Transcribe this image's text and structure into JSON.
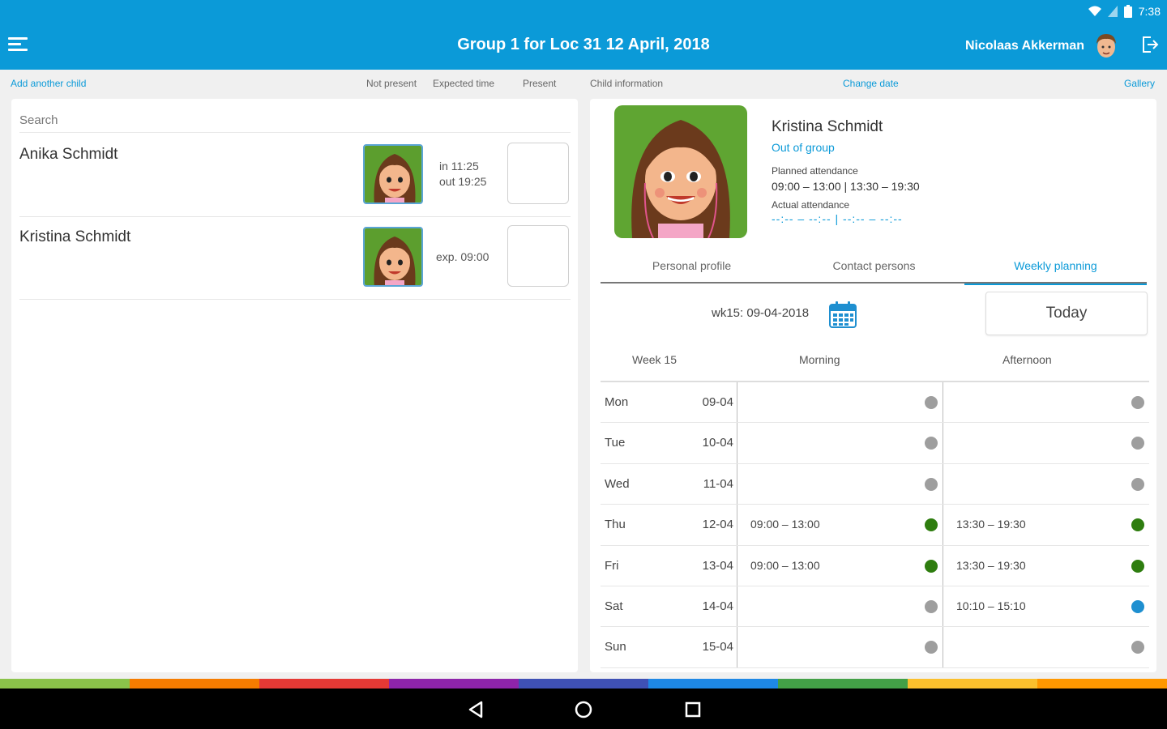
{
  "status_bar": {
    "time": "7:38",
    "icons": [
      "wifi-icon",
      "signal-icon",
      "battery-icon"
    ]
  },
  "app_bar": {
    "title": "Group 1 for Loc 31 12 April, 2018",
    "user_name": "Nicolaas Akkerman",
    "icons": [
      "menu-icon",
      "logout-icon"
    ]
  },
  "sub_header": {
    "add_child": "Add another child",
    "not_present": "Not present",
    "expected_time": "Expected time",
    "present": "Present",
    "child_information": "Child information",
    "change_date": "Change date",
    "gallery": "Gallery"
  },
  "children_list": {
    "search_placeholder": "Search",
    "items": [
      {
        "name": "Anika Schmidt",
        "time_line1": "in 11:25",
        "time_line2": "out 19:25"
      },
      {
        "name": "Kristina Schmidt",
        "time_line1": "exp. 09:00",
        "time_line2": ""
      }
    ]
  },
  "child_detail": {
    "name": "Kristina Schmidt",
    "status_link": "Out of group",
    "planned_label": "Planned attendance",
    "planned_value": "09:00 – 13:00 | 13:30 – 19:30",
    "actual_label": "Actual attendance",
    "actual_value": "--:-- – --:-- | --:-- – --:--"
  },
  "tabs": [
    {
      "label": "Personal profile",
      "active": false
    },
    {
      "label": "Contact persons",
      "active": false
    },
    {
      "label": "Weekly planning",
      "active": true
    }
  ],
  "weekly_planning": {
    "week_selector": "wk15: 09-04-2018",
    "today_button": "Today",
    "headers": {
      "week": "Week 15",
      "morning": "Morning",
      "afternoon": "Afternoon"
    },
    "rows": [
      {
        "day": "Mon",
        "date": "09-04",
        "morning": "",
        "morning_status": "none",
        "afternoon": "",
        "afternoon_status": "none"
      },
      {
        "day": "Tue",
        "date": "10-04",
        "morning": "",
        "morning_status": "none",
        "afternoon": "",
        "afternoon_status": "none"
      },
      {
        "day": "Wed",
        "date": "11-04",
        "morning": "",
        "morning_status": "none",
        "afternoon": "",
        "afternoon_status": "none"
      },
      {
        "day": "Thu",
        "date": "12-04",
        "morning": "09:00 – 13:00",
        "morning_status": "planned",
        "afternoon": "13:30 – 19:30",
        "afternoon_status": "planned"
      },
      {
        "day": "Fri",
        "date": "13-04",
        "morning": "09:00 – 13:00",
        "morning_status": "planned",
        "afternoon": "13:30 – 19:30",
        "afternoon_status": "planned"
      },
      {
        "day": "Sat",
        "date": "14-04",
        "morning": "",
        "morning_status": "none",
        "afternoon": "10:10 – 15:10",
        "afternoon_status": "extra"
      },
      {
        "day": "Sun",
        "date": "15-04",
        "morning": "",
        "morning_status": "none",
        "afternoon": "",
        "afternoon_status": "none"
      }
    ]
  },
  "colors": {
    "primary": "#0b9ad8",
    "status_none": "#9e9e9e",
    "status_planned": "#2e7d0f",
    "status_extra": "#1e8fd0",
    "rainbow": [
      "#8bc34a",
      "#f57c00",
      "#e53935",
      "#8e24aa",
      "#3f51b5",
      "#1e88e5",
      "#43a047",
      "#fbc02d",
      "#ff9800"
    ]
  },
  "nav_bar": {
    "icons": [
      "back-icon",
      "home-icon",
      "recents-icon"
    ]
  }
}
